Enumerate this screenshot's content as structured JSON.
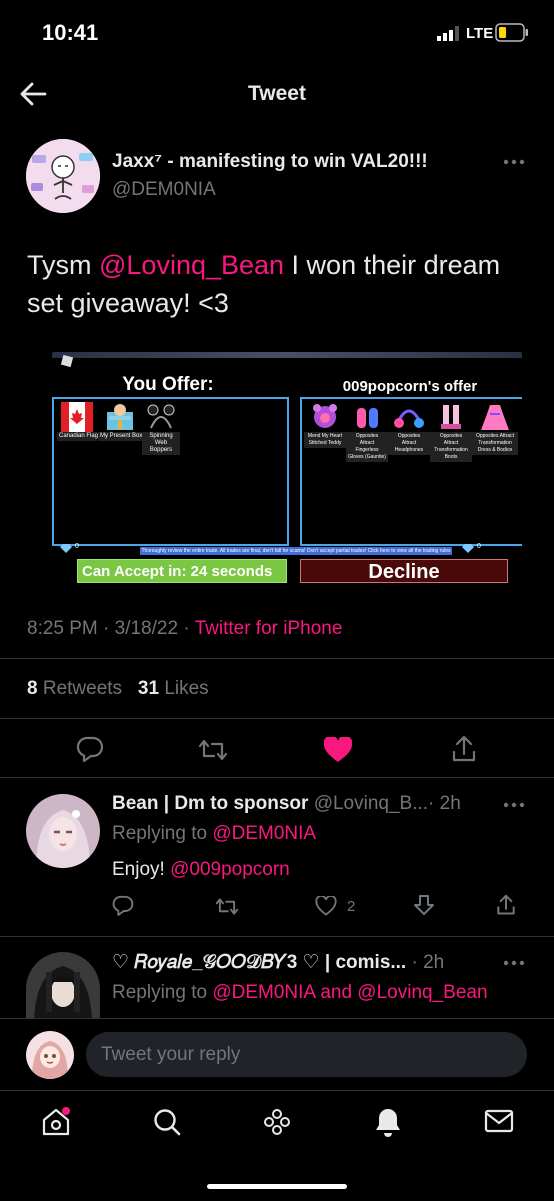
{
  "status": {
    "time": "10:41",
    "network": "LTE"
  },
  "header": {
    "title": "Tweet"
  },
  "tweet": {
    "author_name": "Jaxx⁷ - manifesting to win VAL20!!!",
    "author_handle": "@DEM0NIA",
    "text_before": "Tysm ",
    "mention": "@Lovinq_Bean",
    "text_after": " I won their dream set giveaway! <3",
    "time": "8:25 PM · 3/18/22 · ",
    "source": "Twitter for iPhone",
    "retweets_count": "8",
    "retweets_label": "Retweets",
    "likes_count": "31",
    "likes_label": "Likes",
    "liked": true
  },
  "trade_image": {
    "you_offer_title": "You Offer:",
    "their_offer_title": "009popcorn's offer",
    "your_items": [
      "Canadian Flag",
      "My Present Box",
      "Spinning Web Boppers"
    ],
    "their_items": [
      "Mend My Heart Stitched Teddy",
      "Opposites Attract Fingerless Gloves (Gauntie)",
      "Opposites Attract Headphones",
      "Opposites Attract Transformation Boots",
      "Opposites Attract Transformation Dress & Bodice"
    ],
    "your_diamonds": "0",
    "their_diamonds": "0",
    "review_text": "Thoroughly review the entire trade. All trades are final, don't fall for scams! Don't accept partial trades! Click here to view all the trading rules",
    "accept_label": "Can Accept in: 24 seconds",
    "decline_label": "Decline"
  },
  "replies": [
    {
      "name": "Bean | Dm to sponsor",
      "handle": "@Lovinq_B...",
      "age": "· 2h",
      "replying_prefix": "Replying to ",
      "replying_to": "@DEM0NIA",
      "text": "Enjoy! ",
      "text_mention": "@009popcorn",
      "likes": "2"
    },
    {
      "name": "♡ 𝑅𝑜𝑦𝑎𝑙𝑒_𝒢𝑂𝑂𝒟𝐵𝑌3 ♡ | comis...",
      "age": "· 2h",
      "replying_prefix": "Replying to ",
      "replying_to": "@DEM0NIA and @Lovinq_Bean"
    }
  ],
  "reply_box": {
    "placeholder": "Tweet your reply"
  },
  "colors": {
    "accent": "#f91880",
    "background": "#000000",
    "muted": "#71767b"
  }
}
